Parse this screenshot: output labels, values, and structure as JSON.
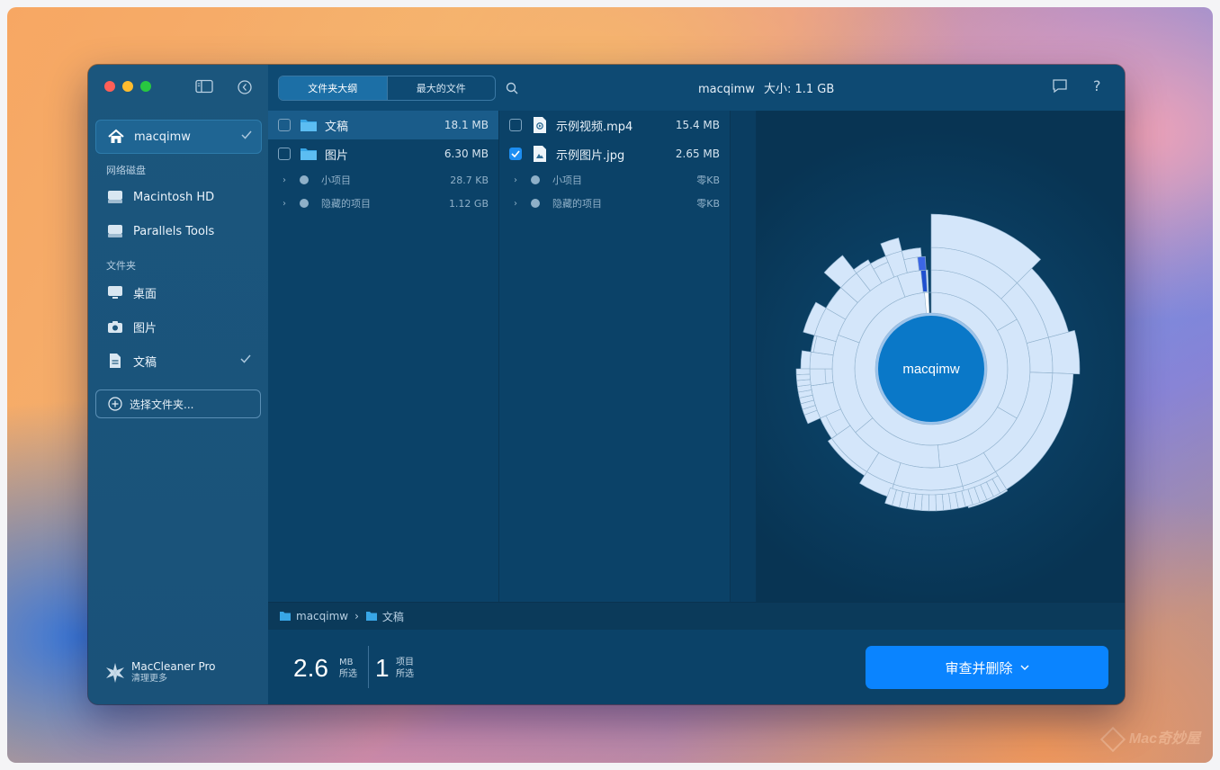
{
  "window": {
    "title": "macqimw",
    "size_label": "大小: 1.1 GB"
  },
  "sidebar": {
    "items": [
      {
        "label": "macqimw",
        "icon": "home-icon",
        "checked": true
      },
      {
        "label": "Macintosh HD",
        "icon": "drive-icon"
      },
      {
        "label": "Parallels Tools",
        "icon": "drive-icon"
      },
      {
        "label": "桌面",
        "icon": "desktop-icon"
      },
      {
        "label": "图片",
        "icon": "camera-icon"
      },
      {
        "label": "文稿",
        "icon": "document-icon",
        "checked": true
      }
    ],
    "sections": {
      "network": "网络磁盘",
      "folders": "文件夹"
    },
    "choose_folder": "选择文件夹...",
    "promo": {
      "title": "MacCleaner Pro",
      "subtitle": "清理更多"
    }
  },
  "tabs": [
    {
      "label": "文件夹大纲",
      "active": true
    },
    {
      "label": "最大的文件",
      "active": false
    }
  ],
  "columns": {
    "left": {
      "rows": [
        {
          "name": "文稿",
          "size": "18.1 MB",
          "checked": false,
          "selected": true
        },
        {
          "name": "图片",
          "size": "6.30 MB",
          "checked": false,
          "selected": false
        }
      ],
      "groups": [
        {
          "name": "小项目",
          "size": "28.7 KB"
        },
        {
          "name": "隐藏的项目",
          "size": "1.12 GB"
        }
      ]
    },
    "right": {
      "rows": [
        {
          "name": "示例视频.mp4",
          "size": "15.4 MB",
          "checked": false
        },
        {
          "name": "示例图片.jpg",
          "size": "2.65 MB",
          "checked": true
        }
      ],
      "groups": [
        {
          "name": "小项目",
          "size": "零KB"
        },
        {
          "name": "隐藏的项目",
          "size": "零KB"
        }
      ]
    }
  },
  "sunburst": {
    "center_label": "macqimw",
    "fill": "#d4e6fa",
    "center": "#0a78c8"
  },
  "breadcrumb": {
    "root": "macqimw",
    "current": "文稿"
  },
  "footer": {
    "size_value": "2.6",
    "size_unit": "MB",
    "size_caption": "所选",
    "count_value": "1",
    "count_unit": "项目",
    "count_caption": "所选",
    "action": "审查并删除"
  },
  "watermark": "Mac奇妙屋",
  "colors": {
    "accent": "#0a84ff",
    "sidebar": "#1b567d",
    "panel": "#0b4268"
  }
}
